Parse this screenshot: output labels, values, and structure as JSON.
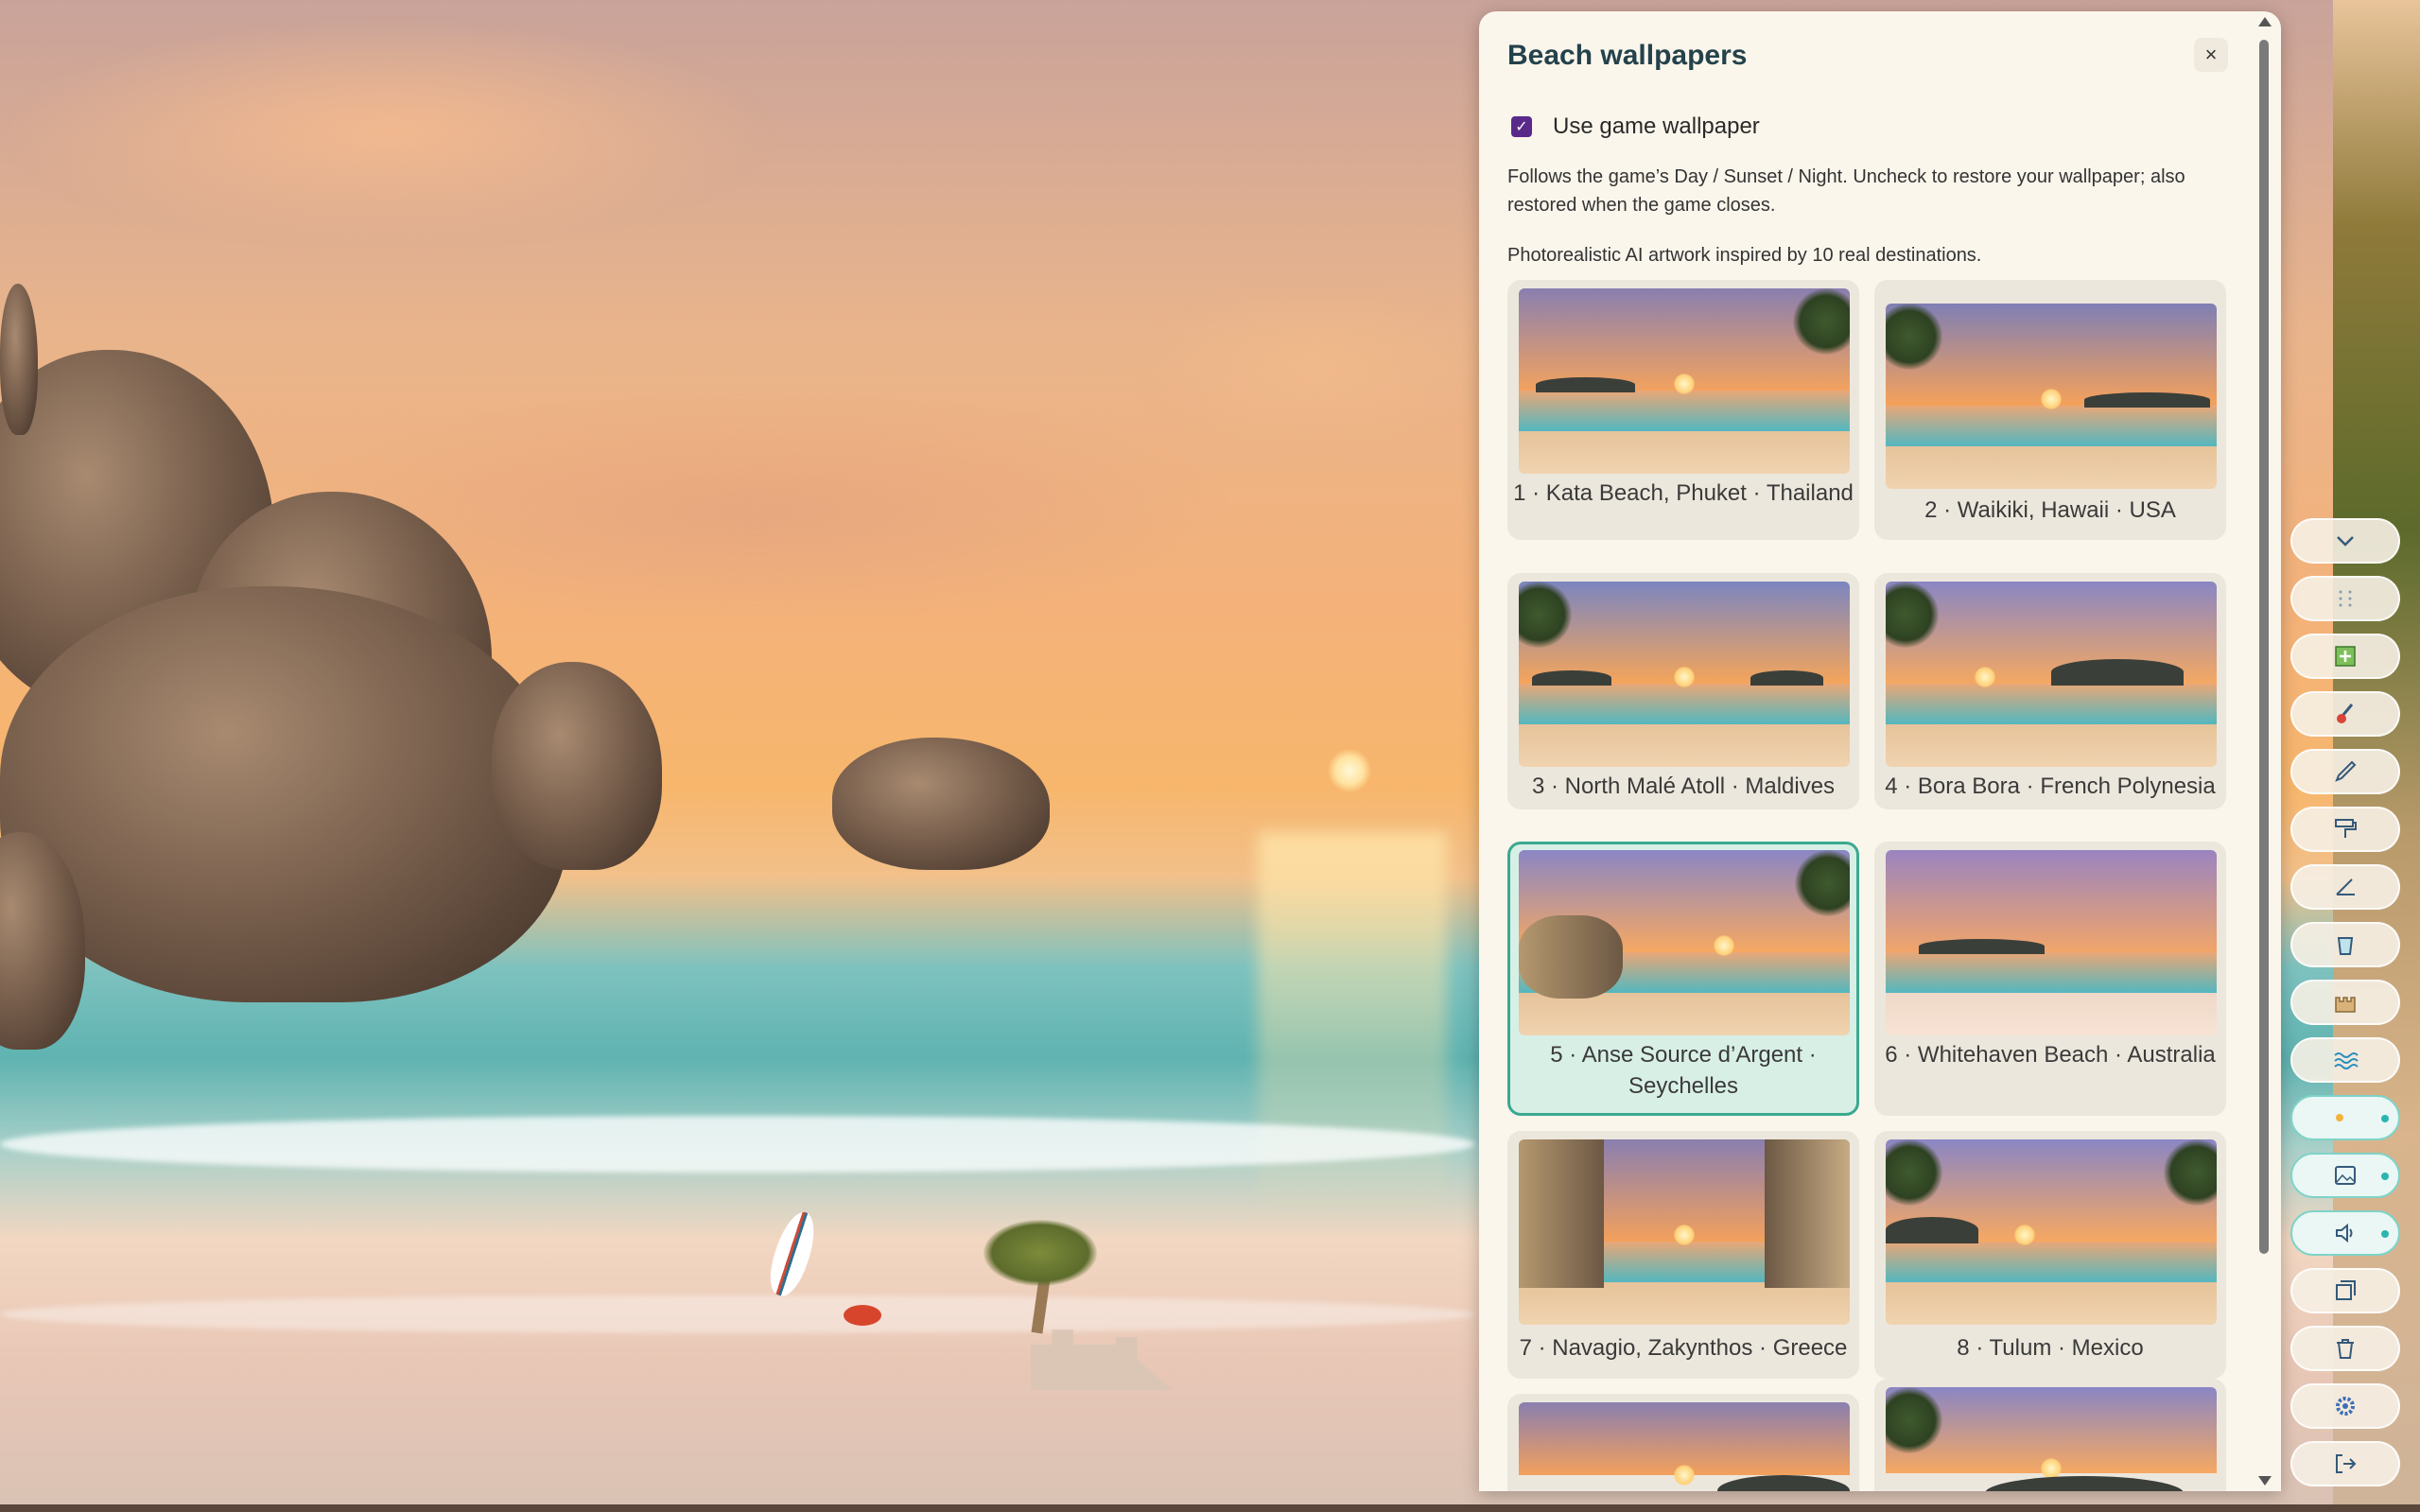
{
  "panel": {
    "title": "Beach wallpapers",
    "close_label": "×",
    "use_game_wallpaper": {
      "label": "Use game wallpaper",
      "checked": true
    },
    "description": "Follows the game’s Day / Sunset / Night. Uncheck to restore your wallpaper; also restored when the game closes.",
    "credit": "Photorealistic AI artwork inspired by 10 real destinations.",
    "wallpapers": [
      {
        "label": "1 · Kata Beach, Phuket · Thailand",
        "selected": false
      },
      {
        "label": "2 · Waikiki, Hawaii · USA",
        "selected": false
      },
      {
        "label": "3 · North Malé Atoll · Maldives",
        "selected": false
      },
      {
        "label": "4 · Bora Bora · French Polynesia",
        "selected": false
      },
      {
        "label": "5 · Anse Source d’Argent · Seychelles",
        "selected": true
      },
      {
        "label": "6 · Whitehaven Beach · Australia",
        "selected": false
      },
      {
        "label": "7 · Navagio, Zakynthos · Greece",
        "selected": false
      },
      {
        "label": "8 · Tulum · Mexico",
        "selected": false
      },
      {
        "label": "",
        "selected": false
      },
      {
        "label": "",
        "selected": false
      }
    ]
  },
  "toolbar": {
    "items": [
      {
        "name": "collapse-button",
        "icon": "chevron-down-icon",
        "active": false
      },
      {
        "name": "grid-button",
        "icon": "dots-grid-icon",
        "active": false
      },
      {
        "name": "add-button",
        "icon": "plus-square-icon",
        "active": false
      },
      {
        "name": "brush-button",
        "icon": "brush-icon",
        "active": false
      },
      {
        "name": "pen-button",
        "icon": "pen-icon",
        "active": false
      },
      {
        "name": "paint-roller-button",
        "icon": "paint-roller-icon",
        "active": false
      },
      {
        "name": "line-tool-button",
        "icon": "angle-icon",
        "active": false
      },
      {
        "name": "bucket-button",
        "icon": "bucket-icon",
        "active": false
      },
      {
        "name": "castle-button",
        "icon": "castle-icon",
        "active": false
      },
      {
        "name": "waves-button",
        "icon": "waves-icon",
        "active": false
      },
      {
        "name": "day-night-toggle",
        "icon": "sun-moon-icon",
        "active": true
      },
      {
        "name": "wallpaper-toggle",
        "icon": "image-icon",
        "active": true
      },
      {
        "name": "sound-toggle",
        "icon": "speaker-icon",
        "active": true
      },
      {
        "name": "window-button",
        "icon": "window-icon",
        "active": false
      },
      {
        "name": "delete-button",
        "icon": "trash-icon",
        "active": false
      },
      {
        "name": "settings-button",
        "icon": "gear-icon",
        "active": false
      },
      {
        "name": "exit-button",
        "icon": "exit-icon",
        "active": false
      }
    ]
  },
  "colors": {
    "panel_bg": "#fbf6ec",
    "title": "#24424b",
    "checkbox": "#5a2a8a",
    "selected_border": "#3aa98f",
    "selected_bg": "#d8efe6",
    "card_bg": "#ece7dc",
    "toolbar_active": "#7fd3c8"
  }
}
